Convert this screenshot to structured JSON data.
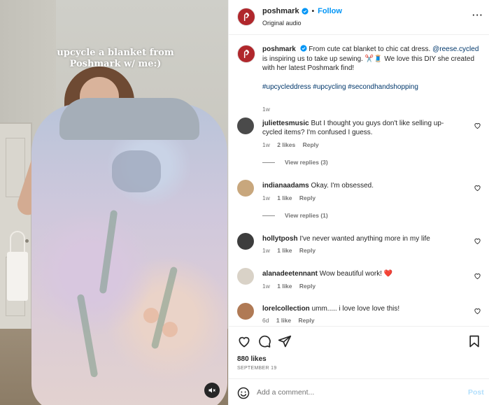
{
  "media": {
    "overlay_caption": "upcycle a blanket from Poshmark w/ me:)",
    "mute_icon": "speaker-muted-icon"
  },
  "header": {
    "username": "poshmark",
    "separator": "•",
    "follow_label": "Follow",
    "audio": "Original audio",
    "more_icon": "more-horizontal-icon",
    "more_label": "···"
  },
  "caption": {
    "username": "poshmark",
    "text_1": "From cute cat blanket to chic cat dress.",
    "mention": "@reese.cycled",
    "text_2": "is inspiring us to take up sewing. ✂️🧵 We love this DIY she created with her latest Poshmark find!",
    "hashtags": "#upcycleddress #upcycling #secondhandshopping",
    "time": "1w"
  },
  "comments": [
    {
      "username": "juliettesmusic",
      "text": "But I thought you guys don't like selling up-cycled items? I'm confused I guess.",
      "time": "1w",
      "likes": "2 likes",
      "reply": "Reply",
      "view_replies": "View replies (3)",
      "avatar_color": "#4a4a4a"
    },
    {
      "username": "indianaadams",
      "text": "Okay. I'm obsessed.",
      "time": "1w",
      "likes": "1 like",
      "reply": "Reply",
      "view_replies": "View replies (1)",
      "avatar_color": "#c8a77d"
    },
    {
      "username": "hollytposh",
      "text": "I've never wanted anything more in my life",
      "time": "1w",
      "likes": "1 like",
      "reply": "Reply",
      "avatar_color": "#3d3d3d"
    },
    {
      "username": "alanadeetennant",
      "text": "Wow beautiful work! ❤️",
      "time": "1w",
      "likes": "1 like",
      "reply": "Reply",
      "avatar_color": "#d9d2c7"
    },
    {
      "username": "lorelcollection",
      "text": "umm..... i love love love this!",
      "time": "6d",
      "likes": "1 like",
      "reply": "Reply",
      "avatar_color": "#b07a55"
    }
  ],
  "actions": {
    "like_icon": "heart-icon",
    "comment_icon": "comment-bubble-icon",
    "share_icon": "paper-plane-icon",
    "save_icon": "bookmark-icon",
    "likes_count": "880 likes",
    "date": "SEPTEMBER 19"
  },
  "comment_bar": {
    "emoji_icon": "emoji-smiley-icon",
    "placeholder": "Add a comment...",
    "post_label": "Post"
  },
  "colors": {
    "brand": "#b0272c",
    "link_blue": "#0095f6",
    "mention_blue": "#00376b",
    "muted_text": "#737373",
    "heart_red": "#ed1d3c"
  }
}
